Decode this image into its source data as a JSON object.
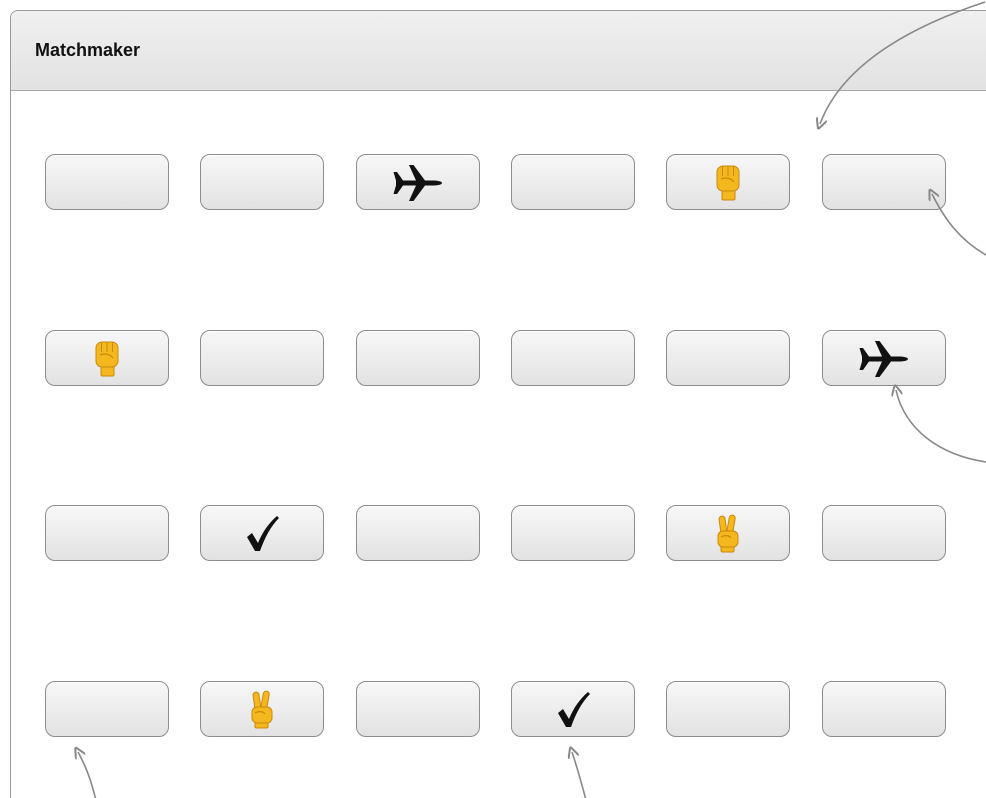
{
  "window": {
    "title": "Matchmaker"
  },
  "board": {
    "columns": 6,
    "rows": 4,
    "cells": [
      [
        "blank",
        "blank",
        "airplane",
        "blank",
        "raised-fist",
        "blank"
      ],
      [
        "raised-fist",
        "blank",
        "blank",
        "blank",
        "blank",
        "airplane"
      ],
      [
        "blank",
        "check-mark",
        "blank",
        "blank",
        "victory-hand",
        "blank"
      ],
      [
        "blank",
        "victory-hand",
        "blank",
        "check-mark",
        "blank",
        "blank"
      ]
    ]
  },
  "colors": {
    "emoji_yellow": "#F4B71D",
    "emoji_outline": "#C98A0C",
    "glyph_black": "#111111",
    "annotation_gray": "#888888"
  }
}
